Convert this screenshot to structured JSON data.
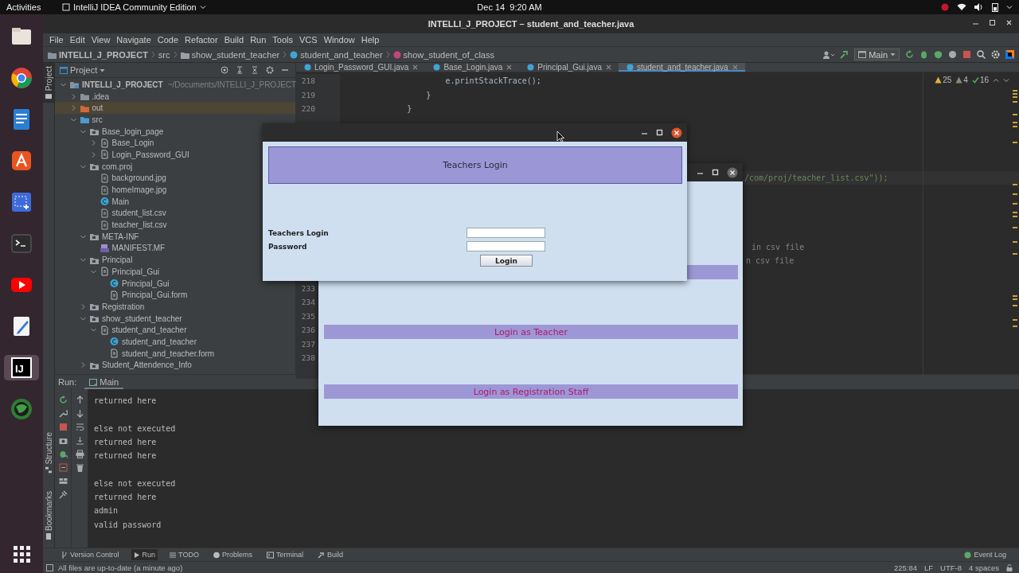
{
  "system_bar": {
    "activities": "Activities",
    "app_menu": "IntelliJ IDEA Community Edition",
    "clock": "Dec 14  9:20 AM"
  },
  "dock": [
    {
      "kind": "files",
      "active": false
    },
    {
      "kind": "browser",
      "active": false
    },
    {
      "kind": "document",
      "active": false
    },
    {
      "kind": "store",
      "active": false
    },
    {
      "kind": "screenshot",
      "active": false
    },
    {
      "kind": "terminal",
      "active": false
    },
    {
      "kind": "video",
      "active": false
    },
    {
      "kind": "editor",
      "active": false
    },
    {
      "kind": "ide",
      "label": "IJ",
      "active": true
    },
    {
      "kind": "globe",
      "active": false
    },
    {
      "kind": "apps",
      "active": false
    }
  ],
  "window": {
    "title": "INTELLI_J_PROJECT – student_and_teacher.java"
  },
  "menu": [
    "File",
    "Edit",
    "View",
    "Navigate",
    "Code",
    "Refactor",
    "Build",
    "Run",
    "Tools",
    "VCS",
    "Window",
    "Help"
  ],
  "breadcrumbs": [
    {
      "kind": "project",
      "label": "INTELLI_J_PROJECT"
    },
    {
      "kind": "folder",
      "label": "src"
    },
    {
      "kind": "package",
      "label": "show_student_teacher"
    },
    {
      "kind": "class",
      "label": "student_and_teacher"
    },
    {
      "kind": "method",
      "label": "show_student_of_class"
    }
  ],
  "run_config": "Main",
  "project_panel": {
    "title": "Project",
    "strip_label": "Project",
    "tree": [
      {
        "kind": "project",
        "label": "INTELLI_J_PROJECT",
        "path": "~/Documents/INTELLI_J_PROJECT",
        "expanded": true,
        "selected": false,
        "children": [
          {
            "kind": "folder",
            "label": ".idea",
            "expanded": false,
            "selected": false
          },
          {
            "kind": "excluded",
            "label": "out",
            "expanded": false,
            "selected": true
          },
          {
            "kind": "source",
            "label": "src",
            "expanded": true,
            "selected": false,
            "children": [
              {
                "kind": "package",
                "label": "Base_login_page",
                "expanded": true,
                "selected": false,
                "children": [
                  {
                    "kind": "form_group",
                    "label": "Base_Login",
                    "expanded": false,
                    "selected": false
                  },
                  {
                    "kind": "form_group",
                    "label": "Login_Password_GUI",
                    "expanded": false,
                    "selected": false
                  }
                ]
              },
              {
                "kind": "package",
                "label": "com.proj",
                "expanded": true,
                "selected": false,
                "children": [
                  {
                    "kind": "file",
                    "label": "background.jpg",
                    "selected": false
                  },
                  {
                    "kind": "file",
                    "label": "homeImage.jpg",
                    "selected": false
                  },
                  {
                    "kind": "class",
                    "label": "Main",
                    "selected": false
                  },
                  {
                    "kind": "file",
                    "label": "student_list.csv",
                    "selected": false
                  },
                  {
                    "kind": "file",
                    "label": "teacher_list.csv",
                    "selected": false
                  }
                ]
              },
              {
                "kind": "package",
                "label": "META-INF",
                "expanded": true,
                "selected": false,
                "children": [
                  {
                    "kind": "manifest",
                    "label": "MANIFEST.MF",
                    "selected": false
                  }
                ]
              },
              {
                "kind": "package",
                "label": "Principal",
                "expanded": true,
                "selected": false,
                "children": [
                  {
                    "kind": "form_group",
                    "label": "Principal_Gui",
                    "expanded": true,
                    "selected": false,
                    "children": [
                      {
                        "kind": "class",
                        "label": "Principal_Gui",
                        "selected": false
                      },
                      {
                        "kind": "form",
                        "label": "Principal_Gui.form",
                        "selected": false
                      }
                    ]
                  }
                ]
              },
              {
                "kind": "package",
                "label": "Registration",
                "expanded": false,
                "selected": false
              },
              {
                "kind": "package",
                "label": "show_student_teacher",
                "expanded": true,
                "selected": false,
                "children": [
                  {
                    "kind": "form_group",
                    "label": "student_and_teacher",
                    "expanded": true,
                    "selected": false,
                    "children": [
                      {
                        "kind": "class",
                        "label": "student_and_teacher",
                        "selected": false
                      },
                      {
                        "kind": "form",
                        "label": "student_and_teacher.form",
                        "selected": false
                      }
                    ]
                  }
                ]
              },
              {
                "kind": "package",
                "label": "Student_Attendence_Info",
                "expanded": false,
                "selected": false
              }
            ]
          }
        ]
      }
    ]
  },
  "editor": {
    "tabs": [
      {
        "label": "Login_Password_GUI.java",
        "selected": false
      },
      {
        "label": "Base_Login.java",
        "selected": false
      },
      {
        "label": "Principal_Gui.java",
        "selected": false
      },
      {
        "label": "student_and_teacher.java",
        "selected": true
      }
    ],
    "inspections": [
      {
        "kind": "warning",
        "count": "25"
      },
      {
        "kind": "weak_warning",
        "count": "4"
      },
      {
        "kind": "typo",
        "count": "16"
      }
    ],
    "lines": [
      {
        "number": "218",
        "code": "                      e.printStackTrace();"
      },
      {
        "number": "219",
        "code": "                  }"
      },
      {
        "number": "220",
        "code": "              }"
      }
    ],
    "fragments": [
      "/com/proj/teacher_list.csv\"));",
      "in csv file",
      "n csv file"
    ],
    "more_numbers": [
      "233",
      "234",
      "235",
      "236",
      "237",
      "238"
    ]
  },
  "run_panel": {
    "label": "Run:",
    "tab": "Main",
    "output": [
      [
        "returned here"
      ],
      [
        "else not executed",
        "returned here",
        "returned here"
      ],
      [
        "else not executed",
        "returned here",
        "admin",
        "valid password"
      ]
    ]
  },
  "side_strip": [
    "Structure",
    "Bookmarks"
  ],
  "tool_windows": [
    {
      "kind": "vcs",
      "label": "Version Control",
      "selected": false
    },
    {
      "kind": "run",
      "label": "Run",
      "selected": true
    },
    {
      "kind": "todo",
      "label": "TODO",
      "selected": false
    },
    {
      "kind": "problems",
      "label": "Problems",
      "selected": false
    },
    {
      "kind": "terminal",
      "label": "Terminal",
      "selected": false
    },
    {
      "kind": "build",
      "label": "Build",
      "selected": false
    }
  ],
  "event_log": "Event Log",
  "status_bar": {
    "message": "All files are up-to-date (a minute ago)",
    "position": "225:84",
    "line_separator": "LF",
    "encoding": "UTF-8",
    "indent": "4 spaces"
  },
  "menu_window": {
    "options": [
      "Login as Teacher",
      "Login as Registration Staff"
    ]
  },
  "login_window": {
    "header": "Teachers Login",
    "fields": [
      {
        "label": "Teachers Login"
      },
      {
        "label": "Password"
      }
    ],
    "button": "Login"
  }
}
